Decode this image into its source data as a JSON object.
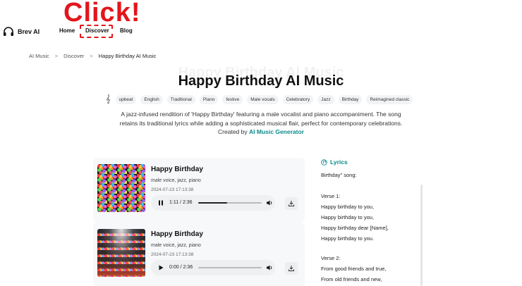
{
  "annotation": {
    "click_text": "Click!"
  },
  "header": {
    "logo_text": "Brev AI",
    "logo_icon": "headphones-icon",
    "nav": [
      {
        "label": "Home"
      },
      {
        "label": "Discover"
      },
      {
        "label": "Blog"
      }
    ]
  },
  "breadcrumb": {
    "items": [
      "AI Music",
      "Discover",
      "Happy Birthday AI Music"
    ],
    "separator": ">"
  },
  "page": {
    "title_ghost": "Happy Birthday AI Music",
    "title": "Happy Birthday AI Music",
    "tag_icon": "music-note-icon",
    "tags": [
      "upbeat",
      "English",
      "Traditional",
      "Piano",
      "festive",
      "Male vocals",
      "Celebratory",
      "Jazz",
      "Birthday",
      "Reimagined classic"
    ],
    "description": "A jazz-infused rendition of 'Happy Birthday' featuring a male vocalist and piano accompaniment. The song retains its traditional lyrics while adding a sophisticated musical flair, perfect for contemporary celebrations. Created by",
    "creator_link": "AI Music Generator"
  },
  "songs": [
    {
      "title": "Happy Birthday",
      "tags": "male voice, jazz, piano",
      "date": "2024-07-23 17:13:38",
      "time": "1:11 / 2:36",
      "progress": 0.455,
      "state": "playing"
    },
    {
      "title": "Happy Birthday",
      "tags": "male voice, jazz, piano",
      "date": "2024-07-23 17:13:38",
      "time": "0:00 / 2:36",
      "progress": 0.0,
      "state": "paused"
    }
  ],
  "lyrics": {
    "heading": "Lyrics",
    "lines": [
      "Birthday\" song:",
      "",
      "Verse 1:",
      "Happy birthday to you,",
      "Happy birthday to you,",
      "Happy birthday dear [Name],",
      "Happy birthday to you.",
      "",
      "Verse 2:",
      "From good friends and true,",
      "From old friends and new,"
    ]
  },
  "colors": {
    "accent": "#0c8a8a",
    "annotation": "#e3161b"
  }
}
